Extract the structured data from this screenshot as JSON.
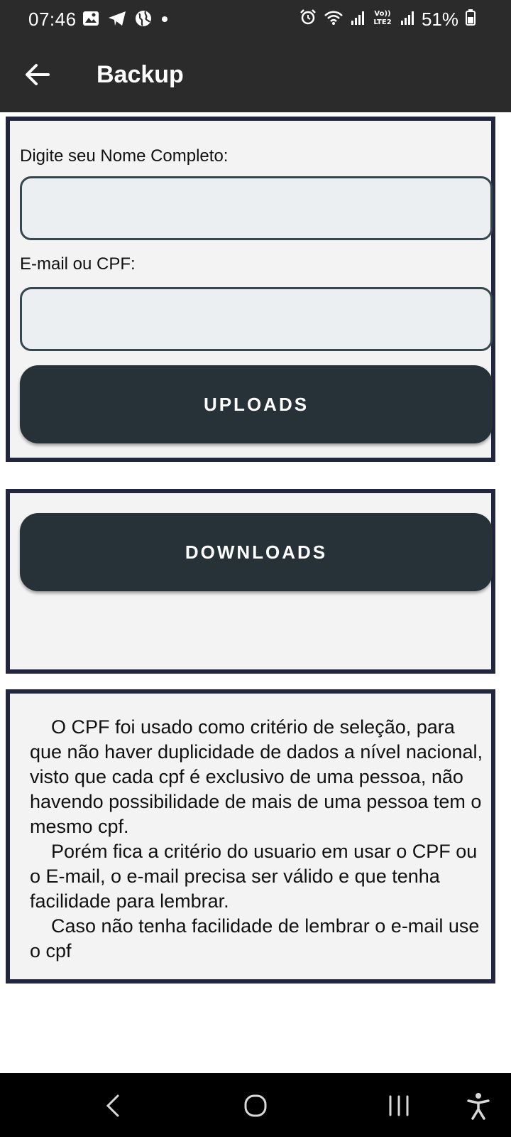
{
  "status_bar": {
    "time": "07:46",
    "battery": "51%",
    "left_icons": [
      "gallery-icon",
      "telegram-icon",
      "globe-icon",
      "dot-icon"
    ],
    "right_icons": [
      "alarm-clock-icon",
      "wifi-icon",
      "signal-icon",
      "volte-icon",
      "signal-icon",
      "battery-icon"
    ]
  },
  "app_bar": {
    "title": "Backup",
    "back_icon": "arrow-left-icon"
  },
  "upload_form": {
    "name_label": "Digite seu Nome Completo:",
    "name_value": "",
    "email_label": "E-mail ou CPF:",
    "email_value": "",
    "uploads_button": "UPLOADS"
  },
  "download_section": {
    "downloads_button": "DOWNLOADS"
  },
  "info": {
    "paragraph1": "O CPF foi usado como critério de seleção, para que não haver duplicidade de dados a nível nacional,  visto que cada cpf é exclusivo de uma pessoa, não havendo possibilidade de mais de uma pessoa tem o mesmo cpf.",
    "paragraph2": "Porém fica a critério do usuario em usar o CPF ou o E-mail, o e-mail precisa ser válido e que tenha facilidade para lembrar.",
    "paragraph3": "Caso não tenha facilidade de lembrar o e-mail use o cpf"
  },
  "nav_bar": {
    "icons": [
      "nav-back-icon",
      "home-icon",
      "recents-icon",
      "accessibility-icon"
    ]
  },
  "colors": {
    "app_bar": "#2b2b2b",
    "card_border": "#23263f",
    "button": "#263238",
    "input_border": "#37474f",
    "input_bg": "#eceff1"
  }
}
